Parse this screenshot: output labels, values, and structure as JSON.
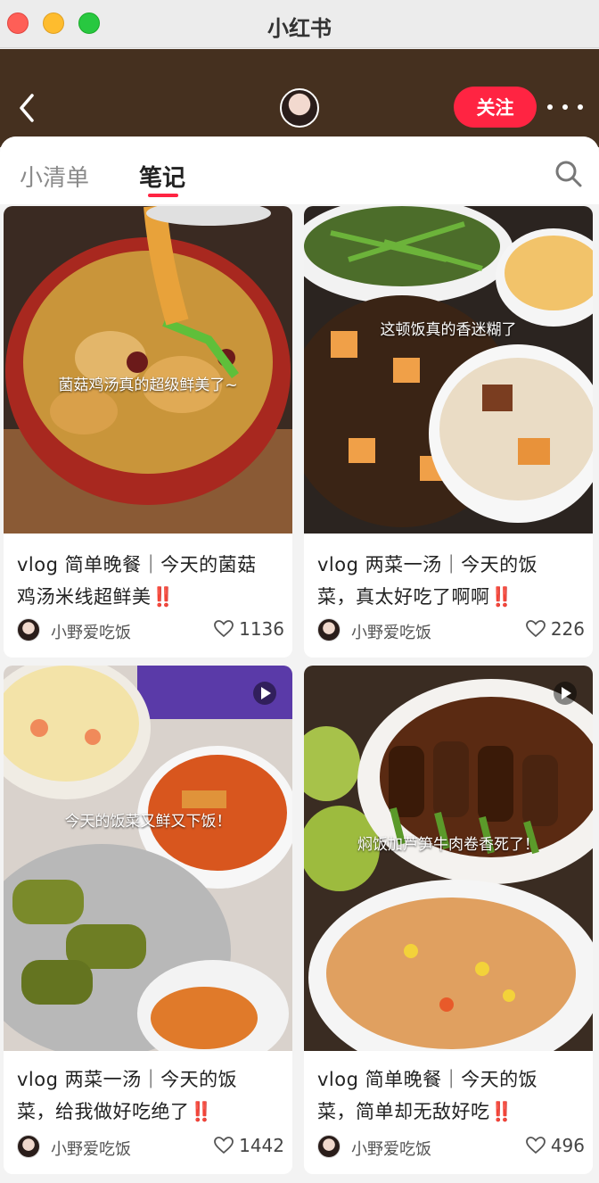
{
  "window": {
    "title": "小红书"
  },
  "header": {
    "follow_label": "关注"
  },
  "tabs": [
    {
      "label": "小清单"
    },
    {
      "label": "笔记"
    }
  ],
  "colors": {
    "accent": "#ff2442",
    "header_bg": "#45301f",
    "exclaim": "#e02020"
  },
  "notes": [
    {
      "overlay": "菌菇鸡汤真的超级鲜美了~",
      "title_line1": "vlog 简单晚餐｜今天的菌菇",
      "title_line2": "鸡汤米线超鲜美",
      "excl": "‼️",
      "author": "小野爱吃饭",
      "likes": "1136",
      "video": false
    },
    {
      "overlay": "这顿饭真的香迷糊了",
      "title_line1": "vlog 两菜一汤｜今天的饭",
      "title_line2": "菜，真太好吃了啊啊",
      "excl": "‼️",
      "author": "小野爱吃饭",
      "likes": "226",
      "video": false
    },
    {
      "overlay": "今天的饭菜又鲜又下饭！",
      "title_line1": "vlog 两菜一汤｜今天的饭",
      "title_line2": "菜，给我做好吃绝了",
      "excl": "‼️",
      "author": "小野爱吃饭",
      "likes": "1442",
      "video": true
    },
    {
      "overlay": "焖饭加芦笋牛肉卷香死了！",
      "title_line1": "vlog 简单晚餐｜今天的饭",
      "title_line2": "菜，简单却无敌好吃",
      "excl": "‼️",
      "author": "小野爱吃饭",
      "likes": "496",
      "video": true
    }
  ]
}
